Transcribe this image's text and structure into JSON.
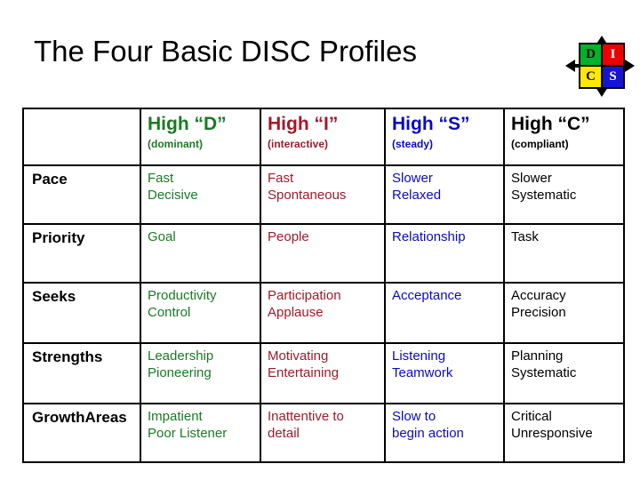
{
  "title": "The Four Basic DISC Profiles",
  "logo": {
    "name": "disc-quadrant-logo",
    "cells": [
      {
        "letter": "D",
        "bg": "#00b32c",
        "fg": "#000000"
      },
      {
        "letter": "I",
        "bg": "#ee0000",
        "fg": "#ffffff"
      },
      {
        "letter": "C",
        "bg": "#ffe800",
        "fg": "#000000"
      },
      {
        "letter": "S",
        "bg": "#1414d2",
        "fg": "#ffffff"
      }
    ]
  },
  "table": {
    "corner_label": "",
    "columns": [
      {
        "key": "D",
        "title": "High “D”",
        "subtitle": "(dominant)",
        "color": "#1a7a23"
      },
      {
        "key": "I",
        "title": "High “I”",
        "subtitle": "(interactive)",
        "color": "#9e1b2a"
      },
      {
        "key": "S",
        "title": "High “S”",
        "subtitle": "(steady)",
        "color": "#0b0bbf"
      },
      {
        "key": "C",
        "title": "High “C”",
        "subtitle": "(compliant)",
        "color": "#000000"
      }
    ],
    "rows": [
      {
        "label": "Pace",
        "D": [
          "Fast",
          "Decisive"
        ],
        "I": [
          "Fast",
          "Spontaneous"
        ],
        "S": [
          "Slower",
          "Relaxed"
        ],
        "C": [
          "Slower",
          "Systematic"
        ]
      },
      {
        "label": "Priority",
        "D": [
          "Goal"
        ],
        "I": [
          "People"
        ],
        "S": [
          "Relationship"
        ],
        "C": [
          "Task"
        ]
      },
      {
        "label": "Seeks",
        "D": [
          "Productivity",
          "Control"
        ],
        "I": [
          "Participation",
          "Applause"
        ],
        "S": [
          "Acceptance"
        ],
        "C": [
          "Accuracy",
          "Precision"
        ]
      },
      {
        "label": "Strengths",
        "D": [
          "Leadership",
          "Pioneering"
        ],
        "I": [
          "Motivating",
          "Entertaining"
        ],
        "S": [
          "Listening",
          "Teamwork"
        ],
        "C": [
          "Planning",
          "Systematic"
        ]
      },
      {
        "label": "Growth Areas",
        "label_lines": [
          "Growth",
          "Areas"
        ],
        "D": [
          "Impatient",
          "Poor Listener"
        ],
        "I": [
          "Inattentive to",
          "detail"
        ],
        "S": [
          "Slow to",
          "begin action"
        ],
        "C": [
          "Critical",
          "Unresponsive"
        ]
      }
    ]
  }
}
